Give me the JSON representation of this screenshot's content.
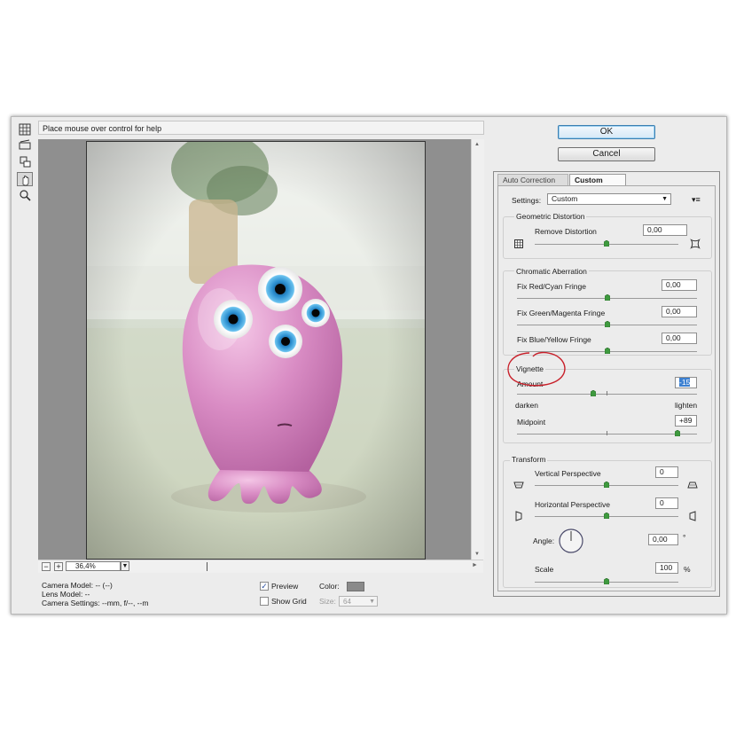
{
  "help_text": "Place mouse over control for help",
  "zoom": {
    "value": "36,4%",
    "minus": "−",
    "plus": "+"
  },
  "camera": {
    "model": "Camera Model: -- (--)",
    "lens": "Lens Model: --",
    "settings": "Camera Settings: --mm, f/--, --m"
  },
  "preview": {
    "label": "Preview",
    "checked": true
  },
  "show_grid": {
    "label": "Show Grid",
    "checked": false
  },
  "color_label": "Color:",
  "grid_color": "#8a8a8a",
  "size": {
    "label": "Size:",
    "value": "64"
  },
  "buttons": {
    "ok": "OK",
    "cancel": "Cancel"
  },
  "tabs": {
    "auto": "Auto Correction",
    "custom": "Custom"
  },
  "settings": {
    "label": "Settings:",
    "value": "Custom"
  },
  "geometric": {
    "title": "Geometric Distortion",
    "remove_label": "Remove Distortion",
    "remove_value": "0,00",
    "slider_fraction": 0.5
  },
  "chromatic": {
    "title": "Chromatic Aberration",
    "items": [
      {
        "label": "Fix Red/Cyan Fringe",
        "value": "0,00",
        "fraction": 0.5
      },
      {
        "label": "Fix Green/Magenta Fringe",
        "value": "0,00",
        "fraction": 0.5
      },
      {
        "label": "Fix Blue/Yellow Fringe",
        "value": "0,00",
        "fraction": 0.5
      }
    ]
  },
  "vignette": {
    "title": "Vignette",
    "amount_label": "Amount",
    "amount_value": "-15",
    "amount_fraction": 0.425,
    "darken": "darken",
    "lighten": "lighten",
    "midpoint_label": "Midpoint",
    "midpoint_value": "+89",
    "midpoint_fraction": 0.89
  },
  "transform": {
    "title": "Transform",
    "vertical_label": "Vertical Perspective",
    "vertical_value": "0",
    "vertical_fraction": 0.5,
    "horizontal_label": "Horizontal Perspective",
    "horizontal_value": "0",
    "horizontal_fraction": 0.5,
    "angle_label": "Angle:",
    "angle_value": "0,00",
    "angle_unit": "°",
    "scale_label": "Scale",
    "scale_value": "100",
    "scale_unit": "%",
    "scale_fraction": 0.5
  },
  "colors": {
    "annotation_circle": "#c8202a",
    "slider_thumb": "#3f9a3f",
    "ok_border": "#3c7fb1"
  }
}
